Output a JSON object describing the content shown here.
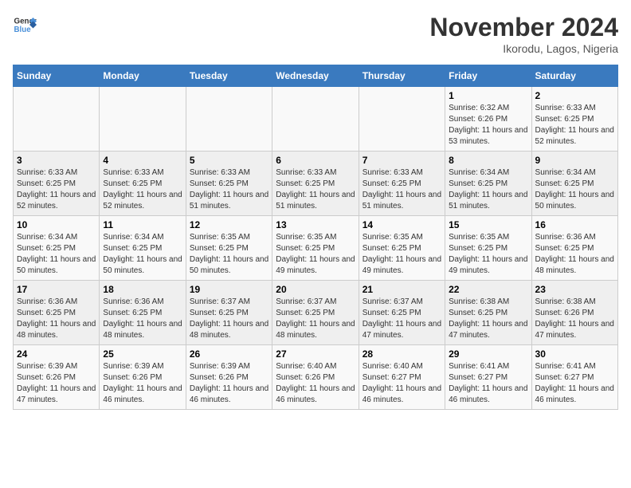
{
  "header": {
    "logo_line1": "General",
    "logo_line2": "Blue",
    "month": "November 2024",
    "location": "Ikorodu, Lagos, Nigeria"
  },
  "weekdays": [
    "Sunday",
    "Monday",
    "Tuesday",
    "Wednesday",
    "Thursday",
    "Friday",
    "Saturday"
  ],
  "weeks": [
    [
      {
        "day": "",
        "info": ""
      },
      {
        "day": "",
        "info": ""
      },
      {
        "day": "",
        "info": ""
      },
      {
        "day": "",
        "info": ""
      },
      {
        "day": "",
        "info": ""
      },
      {
        "day": "1",
        "info": "Sunrise: 6:32 AM\nSunset: 6:26 PM\nDaylight: 11 hours and 53 minutes."
      },
      {
        "day": "2",
        "info": "Sunrise: 6:33 AM\nSunset: 6:25 PM\nDaylight: 11 hours and 52 minutes."
      }
    ],
    [
      {
        "day": "3",
        "info": "Sunrise: 6:33 AM\nSunset: 6:25 PM\nDaylight: 11 hours and 52 minutes."
      },
      {
        "day": "4",
        "info": "Sunrise: 6:33 AM\nSunset: 6:25 PM\nDaylight: 11 hours and 52 minutes."
      },
      {
        "day": "5",
        "info": "Sunrise: 6:33 AM\nSunset: 6:25 PM\nDaylight: 11 hours and 51 minutes."
      },
      {
        "day": "6",
        "info": "Sunrise: 6:33 AM\nSunset: 6:25 PM\nDaylight: 11 hours and 51 minutes."
      },
      {
        "day": "7",
        "info": "Sunrise: 6:33 AM\nSunset: 6:25 PM\nDaylight: 11 hours and 51 minutes."
      },
      {
        "day": "8",
        "info": "Sunrise: 6:34 AM\nSunset: 6:25 PM\nDaylight: 11 hours and 51 minutes."
      },
      {
        "day": "9",
        "info": "Sunrise: 6:34 AM\nSunset: 6:25 PM\nDaylight: 11 hours and 50 minutes."
      }
    ],
    [
      {
        "day": "10",
        "info": "Sunrise: 6:34 AM\nSunset: 6:25 PM\nDaylight: 11 hours and 50 minutes."
      },
      {
        "day": "11",
        "info": "Sunrise: 6:34 AM\nSunset: 6:25 PM\nDaylight: 11 hours and 50 minutes."
      },
      {
        "day": "12",
        "info": "Sunrise: 6:35 AM\nSunset: 6:25 PM\nDaylight: 11 hours and 50 minutes."
      },
      {
        "day": "13",
        "info": "Sunrise: 6:35 AM\nSunset: 6:25 PM\nDaylight: 11 hours and 49 minutes."
      },
      {
        "day": "14",
        "info": "Sunrise: 6:35 AM\nSunset: 6:25 PM\nDaylight: 11 hours and 49 minutes."
      },
      {
        "day": "15",
        "info": "Sunrise: 6:35 AM\nSunset: 6:25 PM\nDaylight: 11 hours and 49 minutes."
      },
      {
        "day": "16",
        "info": "Sunrise: 6:36 AM\nSunset: 6:25 PM\nDaylight: 11 hours and 48 minutes."
      }
    ],
    [
      {
        "day": "17",
        "info": "Sunrise: 6:36 AM\nSunset: 6:25 PM\nDaylight: 11 hours and 48 minutes."
      },
      {
        "day": "18",
        "info": "Sunrise: 6:36 AM\nSunset: 6:25 PM\nDaylight: 11 hours and 48 minutes."
      },
      {
        "day": "19",
        "info": "Sunrise: 6:37 AM\nSunset: 6:25 PM\nDaylight: 11 hours and 48 minutes."
      },
      {
        "day": "20",
        "info": "Sunrise: 6:37 AM\nSunset: 6:25 PM\nDaylight: 11 hours and 48 minutes."
      },
      {
        "day": "21",
        "info": "Sunrise: 6:37 AM\nSunset: 6:25 PM\nDaylight: 11 hours and 47 minutes."
      },
      {
        "day": "22",
        "info": "Sunrise: 6:38 AM\nSunset: 6:25 PM\nDaylight: 11 hours and 47 minutes."
      },
      {
        "day": "23",
        "info": "Sunrise: 6:38 AM\nSunset: 6:26 PM\nDaylight: 11 hours and 47 minutes."
      }
    ],
    [
      {
        "day": "24",
        "info": "Sunrise: 6:39 AM\nSunset: 6:26 PM\nDaylight: 11 hours and 47 minutes."
      },
      {
        "day": "25",
        "info": "Sunrise: 6:39 AM\nSunset: 6:26 PM\nDaylight: 11 hours and 46 minutes."
      },
      {
        "day": "26",
        "info": "Sunrise: 6:39 AM\nSunset: 6:26 PM\nDaylight: 11 hours and 46 minutes."
      },
      {
        "day": "27",
        "info": "Sunrise: 6:40 AM\nSunset: 6:26 PM\nDaylight: 11 hours and 46 minutes."
      },
      {
        "day": "28",
        "info": "Sunrise: 6:40 AM\nSunset: 6:27 PM\nDaylight: 11 hours and 46 minutes."
      },
      {
        "day": "29",
        "info": "Sunrise: 6:41 AM\nSunset: 6:27 PM\nDaylight: 11 hours and 46 minutes."
      },
      {
        "day": "30",
        "info": "Sunrise: 6:41 AM\nSunset: 6:27 PM\nDaylight: 11 hours and 46 minutes."
      }
    ]
  ]
}
